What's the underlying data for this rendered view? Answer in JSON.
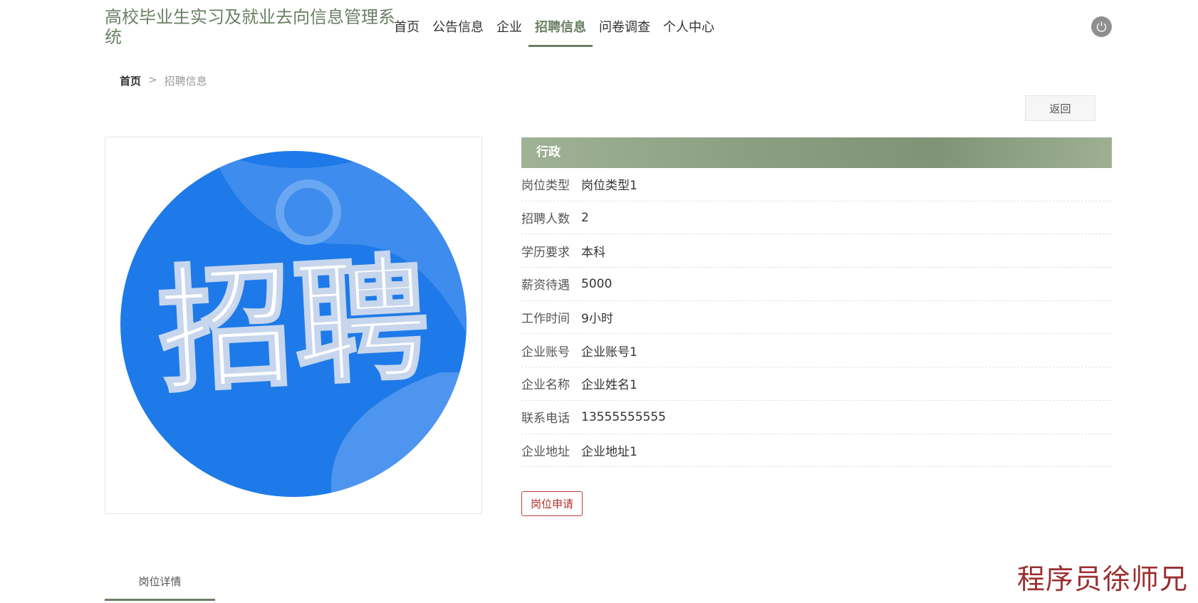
{
  "header": {
    "title": "高校毕业生实习及就业去向信息管理系统",
    "nav": [
      "首页",
      "公告信息",
      "企业",
      "招聘信息",
      "问卷调查",
      "个人中心"
    ],
    "active": "招聘信息",
    "power_icon": "power-icon"
  },
  "breadcrumb": {
    "home": "首页",
    "sep": ">",
    "current": "招聘信息"
  },
  "back_label": "返回",
  "image": {
    "text": "招聘",
    "colors": {
      "bg": "#1e7ae8",
      "text": "#ffffff"
    }
  },
  "detail": {
    "title": "行政",
    "fields": [
      {
        "label": "岗位类型",
        "value": "岗位类型1"
      },
      {
        "label": "招聘人数",
        "value": "2"
      },
      {
        "label": "学历要求",
        "value": "本科"
      },
      {
        "label": "薪资待遇",
        "value": "5000"
      },
      {
        "label": "工作时间",
        "value": "9小时"
      },
      {
        "label": "企业账号",
        "value": "企业账号1"
      },
      {
        "label": "企业名称",
        "value": "企业姓名1"
      },
      {
        "label": "联系电话",
        "value": "13555555555"
      },
      {
        "label": "企业地址",
        "value": "企业地址1"
      }
    ],
    "apply_label": "岗位申请"
  },
  "tabs": [
    "岗位详情"
  ],
  "watermark": "程序员徐师兄",
  "colors": {
    "accent": "#6b8064",
    "apply": "#b0302a"
  }
}
